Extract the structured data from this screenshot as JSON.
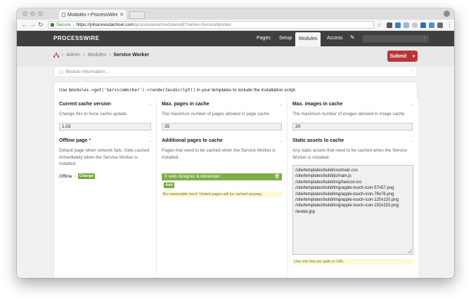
{
  "browser": {
    "tab_title": "Modules • ProcessWire • joha",
    "secure_label": "Secure",
    "url_host": "https://johannesdachsel.com",
    "url_path": "/processwire/module/edit?name=ServiceWorker"
  },
  "masthead": {
    "logo": "PROCESSWIRE",
    "nav": [
      {
        "label": "Pages"
      },
      {
        "label": "Setup"
      },
      {
        "label": "Modules"
      },
      {
        "label": "Access"
      }
    ]
  },
  "breadcrumb": {
    "items": [
      "Admin",
      "Modules"
    ],
    "current": "Service Worker",
    "separator": "›"
  },
  "submit_label": "Submit",
  "module_info_label": "Module Information ...",
  "usage": {
    "prefix": "Use",
    "code": "$modules->get('ServiceWorker')->renderJavaScript()",
    "suffix": "in your templates to include the installation script."
  },
  "fields": {
    "cache_version": {
      "title": "Current cache version",
      "desc": "Change this to force cache update.",
      "value": "1.03"
    },
    "max_pages": {
      "title": "Max. pages in cache",
      "desc": "The maximum number of pages allowed in page cache",
      "value": "35"
    },
    "max_images": {
      "title": "Max. images in cache",
      "desc": "The maximum number of images allowed in image cache",
      "value": "20"
    },
    "offline_page": {
      "title": "Offline page",
      "required": "*",
      "desc": "Default page when network fails. Gets cached immediately when the Service Worker is installed.",
      "value": "Offline",
      "sep": "›",
      "change_label": "Change"
    },
    "additional_pages": {
      "title": "Additional pages to cache",
      "desc": "Pages that need to be cached when the Service Worker is installed.",
      "item": "web designer & developer",
      "add_label": "Add",
      "note": "Be reasonable here! Visited pages will be cached anyway."
    },
    "static_assets": {
      "title": "Static assets to cache",
      "desc": "Any static assets that need to be cached when the Service Worker is installed.",
      "lines": [
        "/site/templates/build/css/main.css",
        "/site/templates/build/js/main.js",
        "/site/templates/build/img/favicon.ico",
        "/site/templates/build/img/apple-touch-icon-57x57.png",
        "/site/templates/build/img/apple-touch-icon-76x76.png",
        "/site/templates/build/img/apple-touch-icon-120x120.png",
        "/site/templates/build/img/apple-touch-icon-152x152.png",
        "/avatar.jpg"
      ],
      "note": "Use one line per path or URL."
    }
  },
  "colors": {
    "masthead": "#3e3f41",
    "submit": "#b9363a",
    "green": "#7fae45",
    "note_bg": "#fcf8d5"
  }
}
